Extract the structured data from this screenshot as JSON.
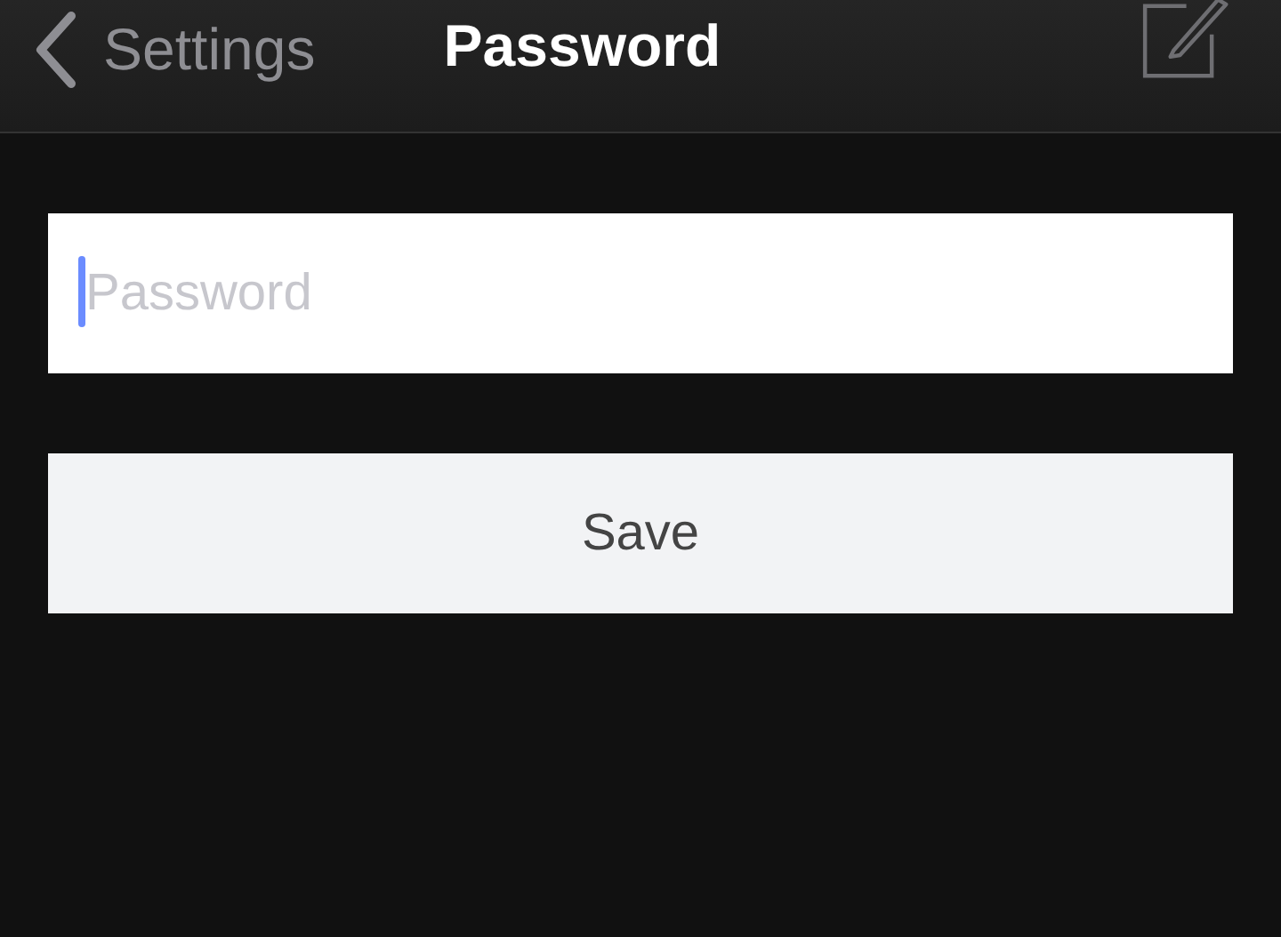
{
  "nav_bar": {
    "back_label": "Settings",
    "title": "Password"
  },
  "password_field": {
    "placeholder": "Password",
    "focused": true
  },
  "save_button": {
    "label": "Save"
  }
}
